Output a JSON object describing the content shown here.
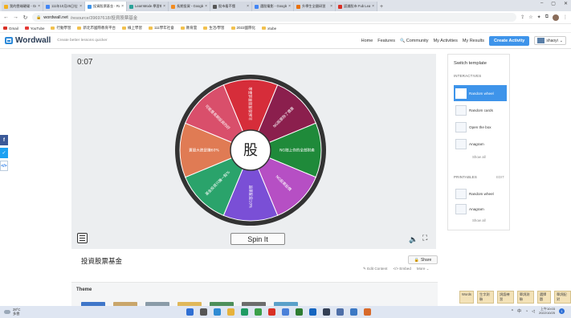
{
  "browser": {
    "tabs": [
      {
        "title": "我的雲端硬碟 - Goog",
        "color": "#f2b01e"
      },
      {
        "title": "111年10月25日社會",
        "color": "#4285f4"
      },
      {
        "title": "投資股票基金 - Rand",
        "color": "#3e94ea",
        "active": true
      },
      {
        "title": "LearnMode 學習吧",
        "color": "#2aa198"
      },
      {
        "title": "長期投資 - Google 搜",
        "color": "#f28b1e"
      },
      {
        "title": "股市看不懂",
        "color": "#555555"
      },
      {
        "title": "選股電影 - Google 搜",
        "color": "#4285f4"
      },
      {
        "title": "升學生全國研習",
        "color": "#e8710a"
      },
      {
        "title": "認識股市 Fub Learn",
        "color": "#d93025"
      }
    ],
    "url_host": "wordwall.net",
    "url_path": "/resource/39697618/投資股票基金",
    "bookmarks": [
      "Gmail",
      "YouTube",
      "行動學習",
      "新北市國際教育平台",
      "線上學習",
      "111學年社會",
      "教育雲",
      "生活/學習",
      "2022國際化",
      "xtube"
    ]
  },
  "header": {
    "logo": "Wordwall",
    "tagline": "Create better lessons quicker",
    "nav": [
      "Home",
      "Features",
      "Community",
      "My Activities",
      "My Results"
    ],
    "create_label": "Create Activity",
    "user": "shaoyi"
  },
  "game": {
    "timer": "0:07",
    "center_label": "股",
    "spin_label": "Spin It",
    "segments": [
      {
        "label": "比起投資股票或基金",
        "color": "#d62d3a"
      },
      {
        "label": "NG股票除了價差",
        "color": "#8b1f4d"
      },
      {
        "label": "NG賠上你的全部財產",
        "color": "#1f8a3a"
      },
      {
        "label": "NG股票股價",
        "color": "#b64fc4"
      },
      {
        "label": "股票配息10%",
        "color": "#7a4fd6"
      },
      {
        "label": "基金投資只賺一點%",
        "color": "#2aa36b"
      },
      {
        "label": "賣股大跌是賺60%",
        "color": "#e07b54"
      },
      {
        "label": "可能是長期投資的好",
        "color": "#d94f6b"
      }
    ]
  },
  "panel": {
    "title": "Switch template",
    "interactives_label": "INTERACTIVES",
    "interactives": [
      "Random wheel",
      "Random cards",
      "Open the box",
      "Anagram"
    ],
    "show_all": "Show all",
    "printables_label": "PRINTABLES",
    "edit_label": "EDIT",
    "printables": [
      "Random wheel",
      "Anagram"
    ]
  },
  "activity": {
    "title": "投資股票基金",
    "share_label": "Share",
    "meta": [
      "Edit Content",
      "Embed",
      "More"
    ]
  },
  "theme": {
    "label": "Theme",
    "thumb_colors": [
      "#3f76c9",
      "#c9a66b",
      "#8a9ba8",
      "#e0b85a",
      "#4d8f5a",
      "#6c6c6c",
      "#5aa0c9"
    ]
  },
  "right_toolbar": [
    "Words",
    "生字測驗",
    "詞語練習",
    "單詞測驗",
    "選擇題",
    "單詞配對"
  ],
  "taskbar": {
    "weather_temp": "28°C",
    "weather_desc": "多雲",
    "time": "上午10:03",
    "date": "2022/10/25",
    "icon_colors": [
      "#2f6fd3",
      "#555555",
      "#2f8bd3",
      "#e6b23c",
      "#1e9b63",
      "#3aa04a",
      "#d93025",
      "#4a80d9",
      "#2e7d32",
      "#1565c0",
      "#333f54",
      "#4e6fa8",
      "#3b78c4",
      "#d86a2a"
    ]
  }
}
